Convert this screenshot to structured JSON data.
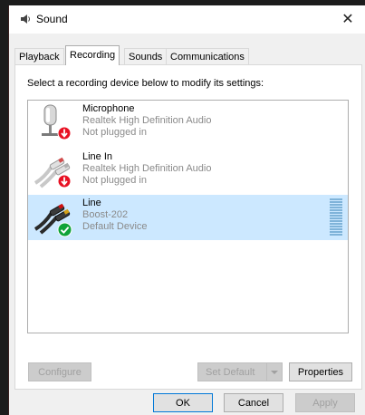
{
  "window": {
    "title": "Sound",
    "close": "✕"
  },
  "tabs": [
    {
      "label": "Playback"
    },
    {
      "label": "Recording"
    },
    {
      "label": "Sounds"
    },
    {
      "label": "Communications"
    }
  ],
  "instruction": "Select a recording device below to modify its settings:",
  "devices": [
    {
      "name": "Microphone",
      "driver": "Realtek High Definition Audio",
      "status": "Not plugged in",
      "icon": "microphone-icon",
      "badge": "unplugged-badge-icon"
    },
    {
      "name": "Line In",
      "driver": "Realtek High Definition Audio",
      "status": "Not plugged in",
      "icon": "rca-cable-icon",
      "badge": "unplugged-badge-icon"
    },
    {
      "name": "Line",
      "driver": "Boost-202",
      "status": "Default Device",
      "icon": "rca-cable-icon",
      "badge": "default-check-icon",
      "selected": true
    }
  ],
  "buttons": {
    "configure": "Configure",
    "set_default": "Set Default",
    "properties": "Properties",
    "ok": "OK",
    "cancel": "Cancel",
    "apply": "Apply"
  },
  "colors": {
    "selection": "#cce8ff",
    "accent": "#0078d7",
    "unplugged": "#e81123",
    "default": "#10a338"
  }
}
